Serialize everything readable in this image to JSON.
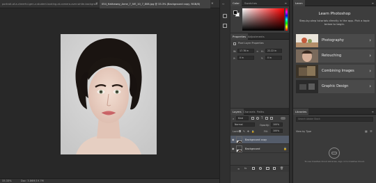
{
  "document_tabs": {
    "tab1": "portrait-of-a-cheerful-gen-z-student-looking-at-camera-over-white-background-0371.jpg",
    "tab2": "054_Hathaway_Anne_7_IVE_10_7_808.jpg @ 33.3% (Background copy, RGB/8)",
    "close": "×",
    "more": "»"
  },
  "status": {
    "zoom": "33.33%",
    "doc": "Doc: 3.86M/19.7M"
  },
  "color_panel": {
    "tab_color": "Color",
    "tab_swatches": "Swatches"
  },
  "properties_panel": {
    "tab_properties": "Properties",
    "tab_adjustments": "Adjustments",
    "section": "Pixel Layer Properties",
    "w_label": "W:",
    "w_value": "17.78 in",
    "h_label": "H:",
    "h_value": "22.22 in",
    "x_label": "X:",
    "x_value": "0 in",
    "y_label": "Y:",
    "y_value": "0 in"
  },
  "layers_panel": {
    "tab_layers": "Layers",
    "tab_channels": "Channels",
    "tab_paths": "Paths",
    "kind": "Kind",
    "blend_mode": "Normal",
    "opacity_label": "Opacity:",
    "opacity_value": "100%",
    "lock_label": "Lock:",
    "fill_label": "Fill:",
    "fill_value": "100%",
    "layers": [
      {
        "name": "Background copy",
        "selected": true
      },
      {
        "name": "Background",
        "selected": false
      }
    ],
    "footer_icons": [
      "link-icon",
      "fx-icon",
      "mask-icon",
      "adjustment-icon",
      "folder-icon",
      "new-layer-icon",
      "trash-icon"
    ]
  },
  "learn_panel": {
    "tab": "Learn",
    "title": "Learn Photoshop",
    "subtitle": "Step-by-step tutorials directly in the app. Pick a topic below to begin.",
    "topics": [
      "Photography",
      "Retouching",
      "Combining Images",
      "Graphic Design"
    ]
  },
  "libraries_panel": {
    "tab": "Libraries",
    "search_placeholder": "Search Adobe Stock",
    "view_by": "View by Type",
    "footer_note": "To use Creative Cloud Libraries, sign in to Creative Cloud."
  },
  "colors": {
    "foreground": "#000000",
    "background": "#ffffff",
    "hue": "#ff0000",
    "selected_layer": "#545c6a"
  }
}
